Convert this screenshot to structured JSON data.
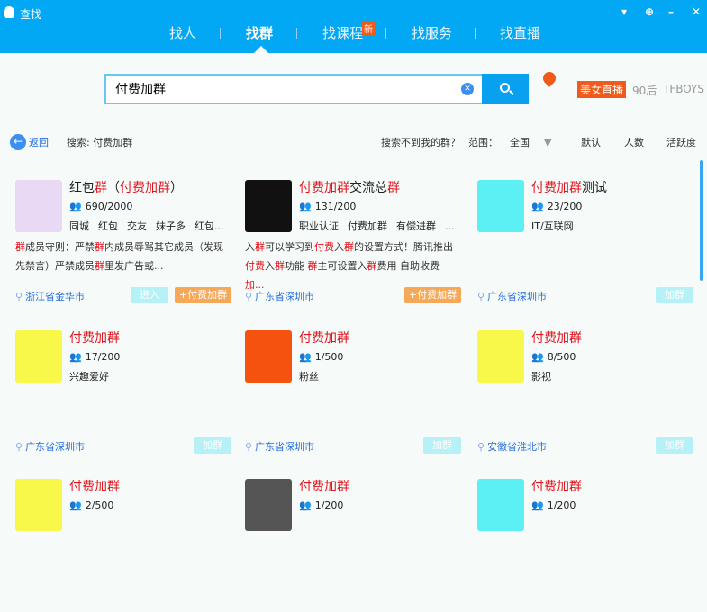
{
  "window": {
    "title": "查找",
    "controls": [
      "feedback",
      "pin",
      "minimize",
      "close"
    ]
  },
  "tabs": [
    {
      "label": "找人"
    },
    {
      "label": "找群",
      "active": true
    },
    {
      "label": "找课程",
      "badge": "新"
    },
    {
      "label": "找服务"
    },
    {
      "label": "找直播"
    }
  ],
  "search": {
    "value": "付费加群",
    "placeholder": ""
  },
  "hot": [
    "美女直播",
    "90后",
    "TFBOYS"
  ],
  "toolbar": {
    "back": "返回",
    "search_label": "搜索: 付费加群",
    "not_found": "搜索不到我的群？",
    "scope_label": "范围：",
    "scope_value": "全国",
    "sort": [
      "默认",
      "人数",
      "活跃度"
    ]
  },
  "colors": {
    "brand": "#02a8f3",
    "highlight": "#e0141e",
    "pay": "#f5a857"
  },
  "cards": [
    {
      "title": [
        [
          "红包",
          0
        ],
        [
          "群",
          1
        ],
        [
          "（",
          0
        ],
        [
          "付费加群",
          1
        ],
        [
          "）",
          0
        ]
      ],
      "members": "690/2000",
      "tags": [
        "同城",
        "红包",
        "交友",
        "妹子多",
        "红包..."
      ],
      "desc": [
        [
          "群",
          1
        ],
        [
          "成员守则：严禁",
          0
        ],
        [
          "群",
          1
        ],
        [
          "内成员辱骂其它成员（发现先禁言）严禁成员",
          0
        ],
        [
          "群",
          1
        ],
        [
          "里发广告或...",
          0
        ]
      ],
      "location": "浙江省金华市",
      "buttons": [
        "进入",
        "+付费加群"
      ],
      "thumb": "#e9d9f5"
    },
    {
      "title": [
        [
          "付费加群",
          1
        ],
        [
          "交流总",
          0
        ],
        [
          "群",
          1
        ]
      ],
      "members": "131/200",
      "tags": [
        "职业认证",
        "付费加群",
        "有偿进群",
        "..."
      ],
      "desc": [
        [
          "入",
          0
        ],
        [
          "群",
          1
        ],
        [
          "可以学习到",
          0
        ],
        [
          "付费",
          1
        ],
        [
          "入",
          0
        ],
        [
          "群",
          1
        ],
        [
          "的设置方式！腾讯推出",
          0
        ],
        [
          "付费",
          1
        ],
        [
          "入",
          0
        ],
        [
          "群",
          1
        ],
        [
          "功能 ",
          0
        ],
        [
          "群",
          1
        ],
        [
          "主可设置入",
          0
        ],
        [
          "群",
          1
        ],
        [
          "费用 自助收费",
          0
        ],
        [
          "加...",
          1
        ]
      ],
      "location": "广东省深圳市",
      "buttons": [
        "+付费加群"
      ],
      "thumb": "#111"
    },
    {
      "title": [
        [
          "付费加群",
          1
        ],
        [
          "测试",
          0
        ]
      ],
      "members": "23/200",
      "tags": [
        "IT/互联网"
      ],
      "desc": [],
      "location": "广东省深圳市",
      "buttons": [
        "加群"
      ],
      "thumb": "#5cf0f4"
    },
    {
      "title": [
        [
          "付费加群",
          1
        ]
      ],
      "members": "17/200",
      "tags": [
        "兴趣爱好"
      ],
      "desc": [],
      "location": "广东省深圳市",
      "buttons": [
        "加群"
      ],
      "thumb": "#f8f84a"
    },
    {
      "title": [
        [
          "付费加群",
          1
        ]
      ],
      "members": "1/500",
      "tags": [
        "粉丝"
      ],
      "desc": [],
      "location": "广东省深圳市",
      "buttons": [
        "加群"
      ],
      "thumb": "#f5520f"
    },
    {
      "title": [
        [
          "付费加群",
          1
        ]
      ],
      "members": "8/500",
      "tags": [
        "影视"
      ],
      "desc": [],
      "location": "安徽省淮北市",
      "buttons": [
        "加群"
      ],
      "thumb": "#f8f84a"
    },
    {
      "title": [
        [
          "付费加群",
          1
        ]
      ],
      "members": "2/500",
      "tags": [],
      "desc": [],
      "location": "",
      "buttons": [],
      "thumb": "#f8f84a"
    },
    {
      "title": [
        [
          "付费加群",
          1
        ]
      ],
      "members": "1/200",
      "tags": [],
      "desc": [],
      "location": "",
      "buttons": [],
      "thumb": "#555"
    },
    {
      "title": [
        [
          "付费加群",
          1
        ]
      ],
      "members": "1/200",
      "tags": [],
      "desc": [],
      "location": "",
      "buttons": [],
      "thumb": "#5cf0f4"
    }
  ]
}
